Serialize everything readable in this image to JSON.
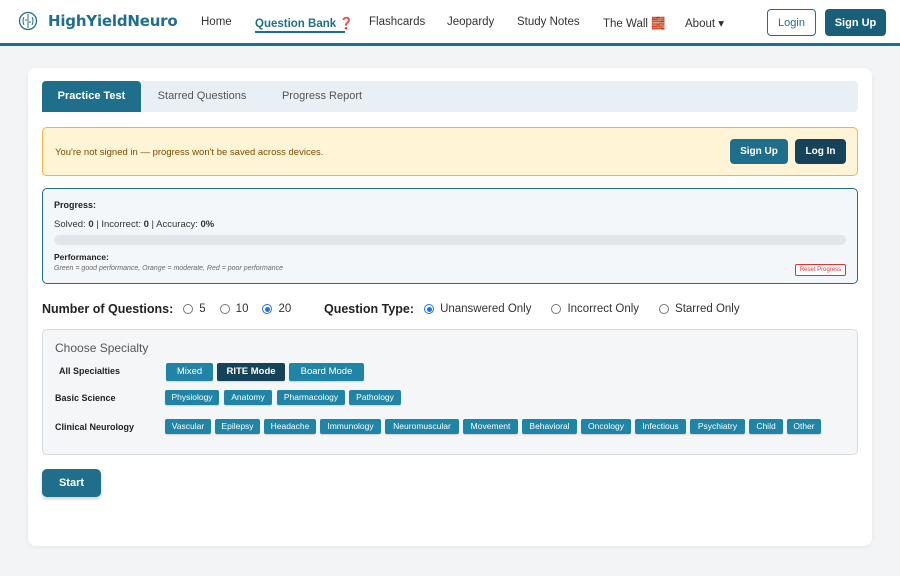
{
  "nav": {
    "brand": "HighYieldNeuro",
    "links": [
      "Home",
      "Question Bank ❓",
      "Flashcards",
      "Jeopardy",
      "Study Notes",
      "The Wall 🧱",
      "About ▾"
    ],
    "login": "Login",
    "signup": "Sign Up"
  },
  "tabs": [
    "Practice Test",
    "Starred Questions",
    "Progress Report"
  ],
  "alert": {
    "text": "You're not signed in — progress won't be saved across devices.",
    "signup": "Sign Up",
    "login": "Log In"
  },
  "progress": {
    "label": "Progress:",
    "solved_label": "Solved:",
    "solved": "0",
    "incorrect_label": "Incorrect:",
    "incorrect": "0",
    "accuracy_label": "Accuracy:",
    "accuracy": "0%",
    "fraction": 0,
    "performance_label": "Performance:",
    "performance_legend": "Green = good performance, Orange = moderate, Red = poor performance",
    "reset": "Reset Progress"
  },
  "options": {
    "num_label": "Number of Questions:",
    "num_choices": [
      "5",
      "10",
      "20"
    ],
    "num_selected": "20",
    "type_label": "Question Type:",
    "type_choices": [
      "Unanswered Only",
      "Incorrect Only",
      "Starred Only"
    ],
    "type_selected": "Unanswered Only"
  },
  "specialty": {
    "title": "Choose Specialty",
    "all_label": "All Specialties",
    "all_chips": [
      "Mixed",
      "RITE Mode",
      "Board Mode"
    ],
    "basic_label": "Basic Science",
    "basic_chips": [
      "Physiology",
      "Anatomy",
      "Pharmacology",
      "Pathology"
    ],
    "clinical_label": "Clinical Neurology",
    "clinical_chips": [
      "Vascular",
      "Epilepsy",
      "Headache",
      "Immunology",
      "Neuromuscular",
      "Movement",
      "Behavioral",
      "Oncology",
      "Infectious",
      "Psychiatry",
      "Child",
      "Other"
    ]
  },
  "start": "Start",
  "colors": {
    "primary": "#1f6e8c",
    "dark": "#15445a",
    "chip": "#1f84a6",
    "alert_bg": "#fff5d6",
    "alert_border": "#f0b63c"
  }
}
